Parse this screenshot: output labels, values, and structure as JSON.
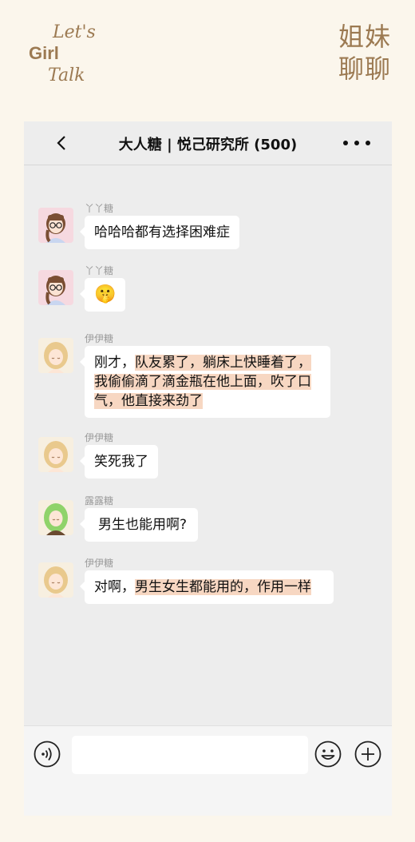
{
  "logo": {
    "line1": "Let's",
    "line2": "Girl",
    "line3": "Talk"
  },
  "side_title": {
    "line1": "姐妹",
    "line2": "聊聊"
  },
  "chat": {
    "title": "大人糖 | 悦己研究所 (500)"
  },
  "messages": [
    {
      "sender": "丫丫糖",
      "text": "哈哈哈都有选择困难症",
      "avatar": "girl-glasses-avatar"
    },
    {
      "sender": "丫丫糖",
      "emoji": "🤫",
      "avatar": "girl-glasses-avatar"
    },
    {
      "sender": "伊伊糖",
      "plain": "刚才，",
      "highlight": "队友累了，躺床上快睡着了，我偷偷滴了滴金瓶在他上面，吹了口气，他直接来劲了",
      "avatar": "blonde-girl-avatar"
    },
    {
      "sender": "伊伊糖",
      "text": "笑死我了",
      "avatar": "blonde-girl-avatar"
    },
    {
      "sender": "露露糖",
      "text": "男生也能用啊?",
      "avatar": "green-hair-girl-avatar"
    },
    {
      "sender": "伊伊糖",
      "plain": "对啊，",
      "highlight": "男生女生都能用的，作用一样",
      "avatar": "blonde-girl-avatar"
    }
  ],
  "input": {
    "placeholder": ""
  },
  "colors": {
    "accent": "#9c7a52",
    "highlight": "#f7d7c2",
    "chat_bg": "#ededed",
    "page_bg": "#fbf6ec"
  }
}
